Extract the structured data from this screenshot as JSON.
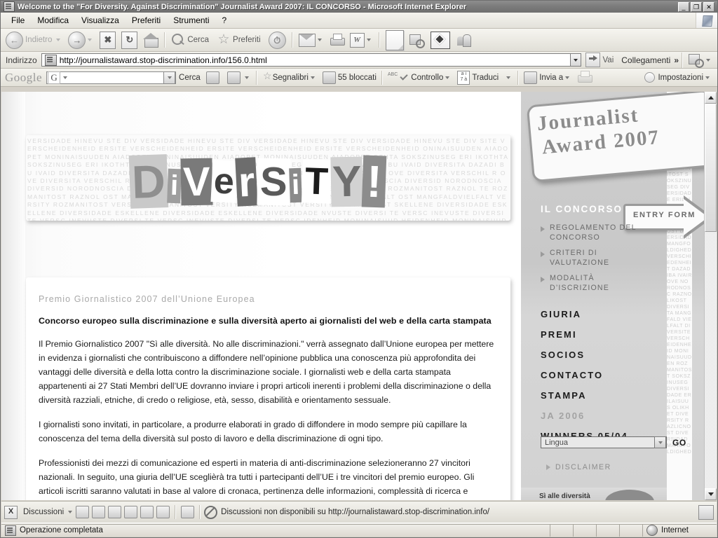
{
  "window": {
    "title": "Welcome to the \"For Diversity. Against Discrimination\" Journalist Award 2007: IL CONCORSO - Microsoft Internet Explorer",
    "minimize": "_",
    "maximize": "❐",
    "close": "✕"
  },
  "menu": {
    "items": [
      {
        "label": "File"
      },
      {
        "label": "Modifica"
      },
      {
        "label": "Visualizza"
      },
      {
        "label": "Preferiti"
      },
      {
        "label": "Strumenti"
      },
      {
        "label": "?"
      }
    ]
  },
  "toolbar": {
    "back": "Indietro",
    "forward": "",
    "stop": "✖",
    "refresh": "↻",
    "home": "",
    "search": "Cerca",
    "favorites": "Preferiti",
    "history": "",
    "mail": "",
    "print": "",
    "edit": "W",
    "blank": "",
    "research": "",
    "messenger": "",
    "diamond": ""
  },
  "address": {
    "label": "Indirizzo",
    "url": "http://journalistaward.stop-discrimination.info/156.0.html",
    "go": "Vai",
    "links": "Collegamenti",
    "chevron": "»"
  },
  "googlebar": {
    "logo": "Google",
    "query_badge": "G",
    "query": "",
    "search": "Cerca",
    "bookmarks": "Segnalibri",
    "blocked": "55 bloccati",
    "check": "Controllo",
    "translate": "Traduci",
    "translate_badge_top": "a i",
    "translate_badge_bottom": "7 à",
    "sendto": "Invia a",
    "abc": "ABC",
    "settings": "Impostazioni"
  },
  "page": {
    "banner": {
      "texture": "VERSIDADE HINEVU STE DIV VERSIDADE HINEVU STE DIV VERSIDADE HINEVU STE DIV VERSIDADE HINEVU STE DIV SITE VERSCHEIDENHEID ERSITE VERSCHEIDENHEID ERSITE VERSCHEIDENHEID ERSITE VERSCHEIDENHEID ONINAISUUDEN AIADOPET MONINAISUUDEN AIADOPET MONINAISUUDEN AIADOPET MONINAISUUDEN AIADOPET OTHTA SOKSZINUSEG ERI IKOTHTA SOKSZINUSEG ERI IKOTHTA SOKSZINUSEG ERI IKOTHTA SOKSZINUSEG ERI VERSITA DAZADI BU IVAID DIVERSITA DAZADI BU IVAID DIVERSITA DAZADI BU IVAID DIVERSITA DAZADI BU IVAID VE DIVERSITA VERSCHIL R OVE DIVERSITA VERSCHIL R OVE DIVERSITA VERSCHIL R OVE DIVERSITA VERSCHIL R NORODNOSCIA DIVERSID NORODNOSCIA DIVERSID NORODNOSCIA DIVERSID NORODNOSCIA DIVERSID TE ROZMANITOST RAZNOL TE ROZMANITOST RAZNOL TE ROZMANITOST RAZNOL TE ROZMANITOST RAZNOL OST MANGFALDVIELFALT OST MANGFALDVIELFALT OST MANGFALDVIELFALT OST MANGFALDVIELFALT VERSITY ROZMANITOST VERSITY ROZMANITOST VERSITY ROZMANITOST VERSITY ROZMANITOST SKELLENE DIVERSIDADE ESKELLENE DIVERSIDADE ESKELLENE DIVERSIDADE ESKELLENE DIVERSIDADE NVUSTE DIVERSI TE VERSC INEVUSTE DIVERSI TE VERSC INEVUSTE DIVERSI TE VERSC INEVUSTE DIVERSI TE VERSC IDENHEID MONINAISUUD HEIDENHEID MONINAISUUD HEIDENHEID MONINAISUUD HEIDENHEID MONINAISUUD AIADOPETIKOTHTA SOKSZ EN AIADOPETIKOTHTA SOKSZ EN AIADOPETIKOTHTA SOKSZ EN AIADOPETIKOTHTA SOKSZ USEG ERI DIVERSITA DAZ INUSEG ERI DIVERSITA DAZ INUSEG ERI DIVERSITA DAZ INUSEG ERI DIVERSITA DAZ I BU IVAIBOVE DIVERSIT ADI BU IVAIBOVE DIVERSIT ADI BU IVAIBOVE DIVERSIT ADI BU IVAIBOVE DIVERSIT",
      "letters": [
        "D",
        "i",
        "V",
        "e",
        "r",
        "S",
        "i",
        "T",
        "Y",
        "!"
      ]
    },
    "content": {
      "kicker": "Premio Giornalistico 2007 dell’Unione Europea",
      "lead": "Concorso europeo sulla discriminazione e sulla diversità aperto ai giornalisti del web e della carta stampata",
      "paragraphs": [
        "Il Premio Giornalistico 2007 \"Sì alle diversità. No alle discriminazioni.\" verrà assegnato dall’Unione europea per mettere in evidenza i giornalisti che contribuiscono a diffondere nell’opinione pubblica una conoscenza più approfondita dei vantaggi delle diversità e della lotta contro la discriminazione sociale. I giornalisti web  e della carta stampata appartenenti ai 27 Stati Membri dell’UE dovranno inviare i propri articoli inerenti i problemi della discriminazione o della diversità razziali, etniche, di credo o religiose, età, sesso, disabilità e orientamento sessuale.",
        "I giornalisti sono invitati, in particolare, a produrre elaborati in grado di diffondere in modo sempre più capillare la conoscenza del tema della diversità sul posto di lavoro e della discriminazione di ogni tipo.",
        "Professionisti dei mezzi di comunicazione ed esperti in materia di anti-discriminazione selezioneranno 27 vincitori nazionali. In seguito, una giuria dell’UE sceglièrà tra tutti i partecipanti dell’UE i tre vincitori del premio europeo. Gli articoli iscritti saranno valutati in base al valore di cronaca, pertinenza delle informazioni, complessità di ricerca e preparazione, originalità, creatività e qualità, e inoltre in base al significato e importanza per il pubblico."
      ]
    },
    "sidebar": {
      "logo_line1": "Journalist",
      "logo_line2": "Award 2007",
      "entry_form": "ENTRY FORM",
      "section_title": "IL CONCORSO",
      "sub_items": [
        "REGOLAMENTO DEL CONCORSO",
        "CRITERI DI VALUTAZIONE",
        "MODALITÀ D’ISCRIZIONE"
      ],
      "nav_items": [
        {
          "label": "GIURIA",
          "muted": false
        },
        {
          "label": "PREMI",
          "muted": false
        },
        {
          "label": "SOCIOS",
          "muted": false
        },
        {
          "label": "CONTACTO",
          "muted": false
        },
        {
          "label": "STAMPA",
          "muted": false
        },
        {
          "label": "JA 2006",
          "muted": true
        },
        {
          "label": "WINNERS 05/04",
          "muted": false
        }
      ],
      "language_value": "Lingua",
      "go_label": "GO",
      "disclaimer": "DISCLAIMER",
      "footer_text": "Sì alle diversità",
      "texture": "DIVERSITA RAZNOLIKOST MANGFALD VIELFALT DIVERSITE VERSCHEIDENHEID MONINAISUUDEN ROZMANITOST SOKSZINUSEG DIVERSIDADE ERILAISUUS OLIKHET DIVERSITY RAZLICNOST DIVERSIDAD MANGFOLDIGHED VERSCHIEDENHEIT DAZADIBA IVAIROVE NORODNOSC RAZNOLIKOST DIVERSITA MANGFALD VIELFALT DIVERSITE VERSCHEIDENHEID MONINAISUUDEN ROZMANITOST SOKSZINUSEG DIVERSIDADE ERILAISUUS OLIKHET DIVERSITY RAZLICNOST DIVERSIDAD MANGFOLDIGHED"
    }
  },
  "discussion_bar": {
    "close": "X",
    "label": "Discussioni",
    "message": "Discussioni non disponibili su http://journalistaward.stop-discrimination.info/"
  },
  "status_bar": {
    "message": "Operazione completata",
    "zone": "Internet"
  }
}
